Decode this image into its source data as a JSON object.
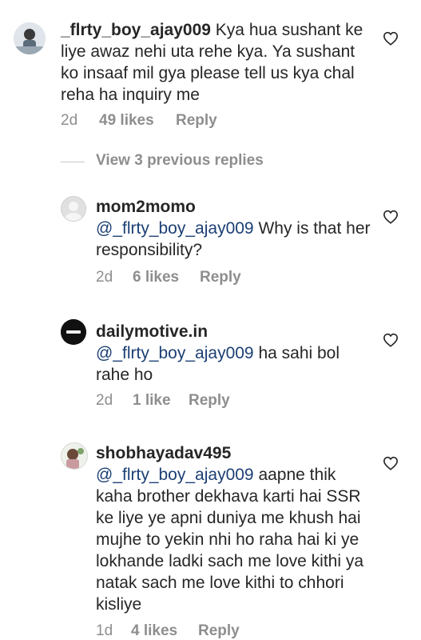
{
  "colors": {
    "text": "#262626",
    "meta": "#8e8e8e",
    "mention": "#1b3f74"
  },
  "comments": [
    {
      "username": "_flrty_boy_ajay009",
      "text": " Kya hua sushant ke liye awaz nehi uta rehe kya. Ya sushant ko insaaf mil gya please tell us kya chal reha ha inquiry me",
      "time": "2d",
      "likes": "49 likes",
      "reply": "Reply",
      "heart_icon": "heart-outline-icon"
    }
  ],
  "view_previous_replies": "View 3 previous replies",
  "replies": [
    {
      "username": "mom2momo",
      "mention": "@_flrty_boy_ajay009",
      "text": " Why is that her responsibility?",
      "time": "2d",
      "likes": "6 likes",
      "reply": "Reply"
    },
    {
      "username": "dailymotive.in",
      "mention": "@_flrty_boy_ajay009",
      "text": " ha sahi bol rahe ho",
      "time": "2d",
      "likes": "1 like",
      "reply": "Reply"
    },
    {
      "username": "shobhayadav495",
      "mention": "@_flrty_boy_ajay009",
      "text": " aapne thik kaha brother dekhava karti hai SSR ke liye ye apni duniya me khush hai mujhe to yekin nhi ho raha hai ki ye lokhande ladki sach me love kithi ya natak sach me love kithi to chhori kisliye",
      "time": "1d",
      "likes": "4 likes",
      "reply": "Reply"
    }
  ]
}
